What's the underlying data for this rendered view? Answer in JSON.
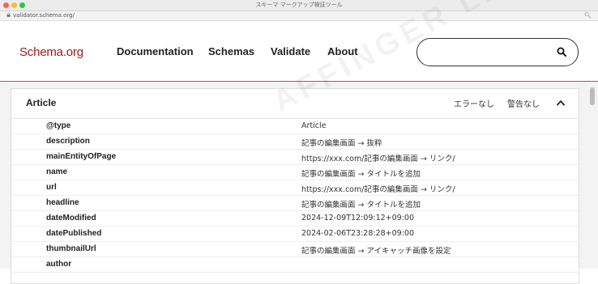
{
  "window": {
    "title": "スキーマ マークアップ検証ツール"
  },
  "browser": {
    "url": "validator.schema.org/"
  },
  "header": {
    "logo": "Schema.org",
    "nav": [
      "Documentation",
      "Schemas",
      "Validate",
      "About"
    ],
    "search": {
      "value": "",
      "placeholder": ""
    }
  },
  "card": {
    "title": "Article",
    "errors_label": "エラーなし",
    "warnings_label": "警告なし",
    "rows": [
      {
        "key": "@type",
        "value": "Article"
      },
      {
        "key": "description",
        "value": "記事の編集画面 → 抜粋"
      },
      {
        "key": "mainEntityOfPage",
        "value": "https://xxx.com/記事の編集画面 → リンク/"
      },
      {
        "key": "name",
        "value": "記事の編集画面 → タイトルを追加"
      },
      {
        "key": "url",
        "value": "https://xxx.com/記事の編集画面 → リンク/"
      },
      {
        "key": "headline",
        "value": "記事の編集画面 → タイトルを追加"
      },
      {
        "key": "dateModified",
        "value": "2024-12-09T12:09:12+09:00"
      },
      {
        "key": "datePublished",
        "value": "2024-02-06T23:28:28+09:00"
      },
      {
        "key": "thumbnailUrl",
        "value": "記事の編集画面 → アイキャッチ画像を設定"
      },
      {
        "key": "author",
        "value": ""
      }
    ]
  },
  "watermark": "AFFINGER LABO.",
  "icons": {
    "lock": "lock-icon",
    "zoom": "zoom-icon",
    "search": "search-icon",
    "collapse": "chevron-up-icon"
  },
  "colors": {
    "brand": "#a01919",
    "divider": "#c74b4b"
  }
}
